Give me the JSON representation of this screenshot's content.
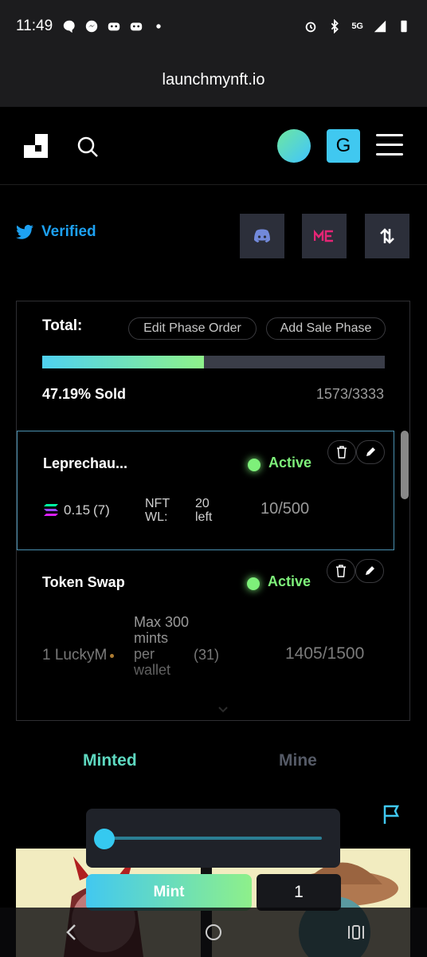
{
  "statusbar": {
    "time": "11:49",
    "network": "5G"
  },
  "url": "launchmynft.io",
  "header": {
    "avatar_letter": "G"
  },
  "verified": {
    "label": "Verified"
  },
  "total": {
    "label": "Total:",
    "edit_phase_order": "Edit Phase Order",
    "add_sale_phase": "Add Sale Phase",
    "progress_fraction": 0.4719,
    "sold_text": "47.19% Sold",
    "count_text": "1573/3333"
  },
  "phases": [
    {
      "name": "Leprechau...",
      "status": "Active",
      "price": "0.15",
      "price_count": "(7)",
      "nft_label": "NFT WL:",
      "left": "20 left",
      "minted": "10/500"
    },
    {
      "name": "Token Swap",
      "status": "Active",
      "price": "1 LuckyM",
      "limit": "Max 300 mints per wallet",
      "price_count": "(31)",
      "minted": "1405/1500"
    }
  ],
  "tabs": {
    "minted": "Minted",
    "mine": "Mine"
  },
  "mint": {
    "button": "Mint",
    "quantity": "1"
  },
  "colors": {
    "accent": "#40c8f0",
    "active": "#7ef07a",
    "twitter": "#1da1f2"
  }
}
